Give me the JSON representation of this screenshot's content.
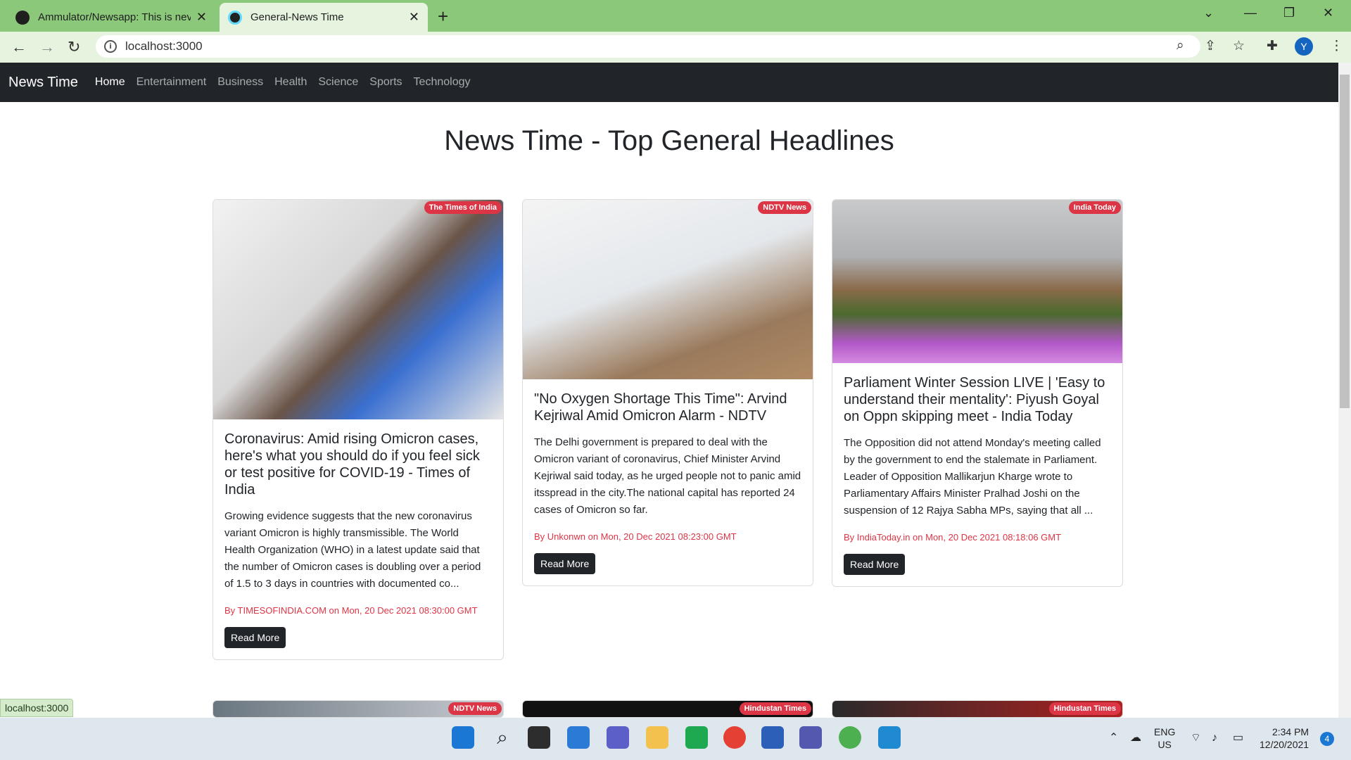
{
  "browser": {
    "tabs": [
      {
        "title": "Ammulator/Newsapp: This is nev"
      },
      {
        "title": "General-News Time"
      }
    ],
    "url": "localhost:3000",
    "profile_initial": "Y",
    "status_url": "localhost:3000"
  },
  "navbar": {
    "brand": "News Time",
    "links": [
      "Home",
      "Entertainment",
      "Business",
      "Health",
      "Science",
      "Sports",
      "Technology"
    ]
  },
  "page": {
    "heading": "News Time - Top General Headlines"
  },
  "cards": [
    {
      "source": "The Times of India",
      "title": "Coronavirus: Amid rising Omicron cases, here's what you should do if you feel sick or test positive for COVID-19 - Times of India",
      "description": "Growing evidence suggests that the new coronavirus variant Omicron is highly transmissible. The World Health Organization (WHO) in a latest update said that the number of Omicron cases is doubling over a period of 1.5 to 3 days in countries with documented co...",
      "meta": "By TIMESOFINDIA.COM on Mon, 20 Dec 2021 08:30:00 GMT",
      "button": "Read More"
    },
    {
      "source": "NDTV News",
      "title": "\"No Oxygen Shortage This Time\": Arvind Kejriwal Amid Omicron Alarm - NDTV",
      "description": "The Delhi government is prepared to deal with the Omicron variant of coronavirus, Chief Minister Arvind Kejriwal said today, as he urged people not to panic amid itsspread in the city.The national capital has reported 24 cases of Omicron so far.",
      "meta": "By Unkonwn on Mon, 20 Dec 2021 08:23:00 GMT",
      "button": "Read More"
    },
    {
      "source": "India Today",
      "title": "Parliament Winter Session LIVE | 'Easy to understand their mentality': Piyush Goyal on Oppn skipping meet - India Today",
      "description": "The Opposition did not attend Monday's meeting called by the government to end the stalemate in Parliament. Leader of Opposition Mallikarjun Kharge wrote to Parliamentary Affairs Minister Pralhad Joshi on the suspension of 12 Rajya Sabha MPs, saying that all ...",
      "meta": "By IndiaToday.in on Mon, 20 Dec 2021 08:18:06 GMT",
      "button": "Read More"
    }
  ],
  "next_row_sources": [
    "NDTV News",
    "Hindustan Times",
    "Hindustan Times"
  ],
  "taskbar": {
    "lang": "ENG",
    "region": "US",
    "time": "2:34 PM",
    "date": "12/20/2021",
    "notifications": "4"
  }
}
